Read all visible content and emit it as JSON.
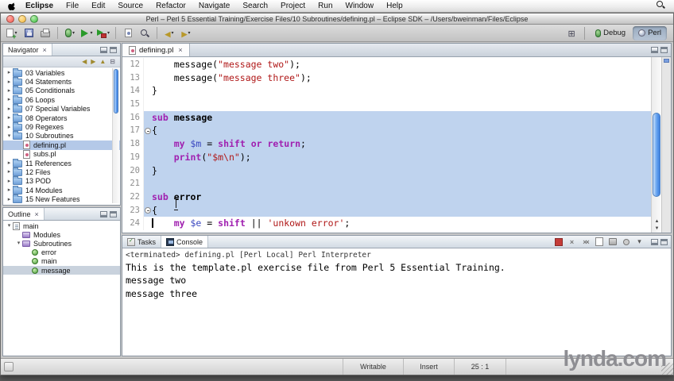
{
  "menubar": {
    "items": [
      "Eclipse",
      "File",
      "Edit",
      "Source",
      "Refactor",
      "Navigate",
      "Search",
      "Project",
      "Run",
      "Window",
      "Help"
    ]
  },
  "window": {
    "title": "Perl – Perl 5 Essential Training/Exercise Files/10 Subroutines/defining.pl – Eclipse SDK – /Users/bweinman/Files/Eclipse"
  },
  "toolbar": {
    "buttons": [
      {
        "name": "new",
        "icon": "new",
        "dd": true
      },
      {
        "name": "save",
        "icon": "save"
      },
      {
        "name": "print",
        "icon": "print"
      },
      "|",
      {
        "name": "debug",
        "icon": "debug",
        "dd": true
      },
      {
        "name": "run",
        "icon": "run",
        "dd": true
      },
      {
        "name": "external-tools",
        "icon": "ext",
        "dd": true
      },
      "|",
      {
        "name": "new-perl-file",
        "icon": "perlfile"
      },
      {
        "name": "search",
        "icon": "search"
      },
      "|",
      {
        "name": "back",
        "icon": "back",
        "dd": true
      },
      {
        "name": "forward",
        "icon": "forward",
        "dd": true
      }
    ],
    "perspectives": [
      {
        "label": "Debug",
        "active": false
      },
      {
        "label": "Perl",
        "active": true
      }
    ]
  },
  "navigator": {
    "title": "Navigator",
    "toolbar_icons": [
      "back",
      "forward",
      "up",
      "collapse-all"
    ],
    "items": [
      {
        "label": "03 Variables",
        "depth": 0,
        "type": "folder",
        "expanded": false
      },
      {
        "label": "04 Statements",
        "depth": 0,
        "type": "folder",
        "expanded": false
      },
      {
        "label": "05 Conditionals",
        "depth": 0,
        "type": "folder",
        "expanded": false
      },
      {
        "label": "06 Loops",
        "depth": 0,
        "type": "folder",
        "expanded": false
      },
      {
        "label": "07 Special Variables",
        "depth": 0,
        "type": "folder",
        "expanded": false
      },
      {
        "label": "08 Operators",
        "depth": 0,
        "type": "folder",
        "expanded": false
      },
      {
        "label": "09 Regexes",
        "depth": 0,
        "type": "folder",
        "expanded": false
      },
      {
        "label": "10 Subroutines",
        "depth": 0,
        "type": "folder",
        "expanded": true
      },
      {
        "label": "defining.pl",
        "depth": 1,
        "type": "perl-file",
        "selected": true
      },
      {
        "label": "subs.pl",
        "depth": 1,
        "type": "perl-file"
      },
      {
        "label": "11 References",
        "depth": 0,
        "type": "folder",
        "expanded": false
      },
      {
        "label": "12 Files",
        "depth": 0,
        "type": "folder",
        "expanded": false
      },
      {
        "label": "13 POD",
        "depth": 0,
        "type": "folder",
        "expanded": false
      },
      {
        "label": "14 Modules",
        "depth": 0,
        "type": "folder",
        "expanded": false
      },
      {
        "label": "15 New Features",
        "depth": 0,
        "type": "folder",
        "expanded": false
      }
    ]
  },
  "outline": {
    "title": "Outline",
    "items": [
      {
        "label": "main",
        "depth": 0,
        "icon": "file",
        "expanded": true
      },
      {
        "label": "Modules",
        "depth": 1,
        "icon": "group"
      },
      {
        "label": "Subroutines",
        "depth": 1,
        "icon": "group",
        "expanded": true
      },
      {
        "label": "error",
        "depth": 2,
        "icon": "sub"
      },
      {
        "label": "main",
        "depth": 2,
        "icon": "sub"
      },
      {
        "label": "message",
        "depth": 2,
        "icon": "sub",
        "selected": true
      }
    ]
  },
  "editor": {
    "tab": "defining.pl",
    "lines": [
      {
        "n": 12,
        "sel": false,
        "seg": [
          [
            "p",
            "    message("
          ],
          [
            "s",
            "\"message two\""
          ],
          [
            "p",
            ");"
          ]
        ]
      },
      {
        "n": 13,
        "sel": false,
        "seg": [
          [
            "p",
            "    message("
          ],
          [
            "s",
            "\"message three\""
          ],
          [
            "p",
            ");"
          ]
        ]
      },
      {
        "n": 14,
        "sel": false,
        "seg": [
          [
            "p",
            "}"
          ]
        ]
      },
      {
        "n": 15,
        "sel": false,
        "seg": []
      },
      {
        "n": 16,
        "sel": true,
        "seg": [
          [
            "k",
            "sub"
          ],
          [
            "p",
            " "
          ],
          [
            "b",
            "message"
          ]
        ]
      },
      {
        "n": 17,
        "sel": true,
        "fold": true,
        "seg": [
          [
            "p",
            "{"
          ]
        ]
      },
      {
        "n": 18,
        "sel": true,
        "seg": [
          [
            "p",
            "    "
          ],
          [
            "k",
            "my"
          ],
          [
            "p",
            " "
          ],
          [
            "v",
            "$m"
          ],
          [
            "p",
            " = "
          ],
          [
            "k",
            "shift"
          ],
          [
            "p",
            " "
          ],
          [
            "k",
            "or"
          ],
          [
            "p",
            " "
          ],
          [
            "k",
            "return"
          ],
          [
            "p",
            ";"
          ]
        ]
      },
      {
        "n": 19,
        "sel": true,
        "seg": [
          [
            "p",
            "    "
          ],
          [
            "k",
            "print"
          ],
          [
            "p",
            "("
          ],
          [
            "s",
            "\"$m\\n\""
          ],
          [
            "p",
            ");"
          ]
        ]
      },
      {
        "n": 20,
        "sel": true,
        "seg": [
          [
            "p",
            "}"
          ]
        ]
      },
      {
        "n": 21,
        "sel": true,
        "seg": []
      },
      {
        "n": 22,
        "sel": true,
        "seg": [
          [
            "k",
            "sub"
          ],
          [
            "p",
            " "
          ],
          [
            "b",
            "error"
          ]
        ]
      },
      {
        "n": 23,
        "sel": true,
        "fold": true,
        "seg": [
          [
            "p",
            "{"
          ]
        ]
      },
      {
        "n": 24,
        "sel": false,
        "caret": true,
        "seg": [
          [
            "p",
            "    "
          ],
          [
            "k",
            "my"
          ],
          [
            "p",
            " "
          ],
          [
            "v",
            "$e"
          ],
          [
            "p",
            " = "
          ],
          [
            "k",
            "shift"
          ],
          [
            "p",
            " || "
          ],
          [
            "s",
            "'unkown error'"
          ],
          [
            "p",
            ";"
          ]
        ]
      }
    ]
  },
  "console": {
    "tabs": [
      {
        "label": "Tasks",
        "active": false
      },
      {
        "label": "Console",
        "active": true
      }
    ],
    "toolbar_icons": [
      "terminate",
      "remove-launch",
      "remove-all-launches",
      "clear-console",
      "scroll-lock",
      "pin-console",
      "open-console"
    ],
    "status_line": "<terminated> defining.pl [Perl Local] Perl Interpreter",
    "output": [
      "This is the template.pl exercise file from Perl 5 Essential Training.",
      "message two",
      "message three"
    ]
  },
  "statusbar": {
    "writable": "Writable",
    "insert_mode": "Insert",
    "position": "25 : 1"
  },
  "watermark": "lynda.com",
  "colors": {
    "keyword": "#a020b0",
    "string": "#b01818",
    "variable": "#3a48c0",
    "selection": "#bfd3ee"
  }
}
